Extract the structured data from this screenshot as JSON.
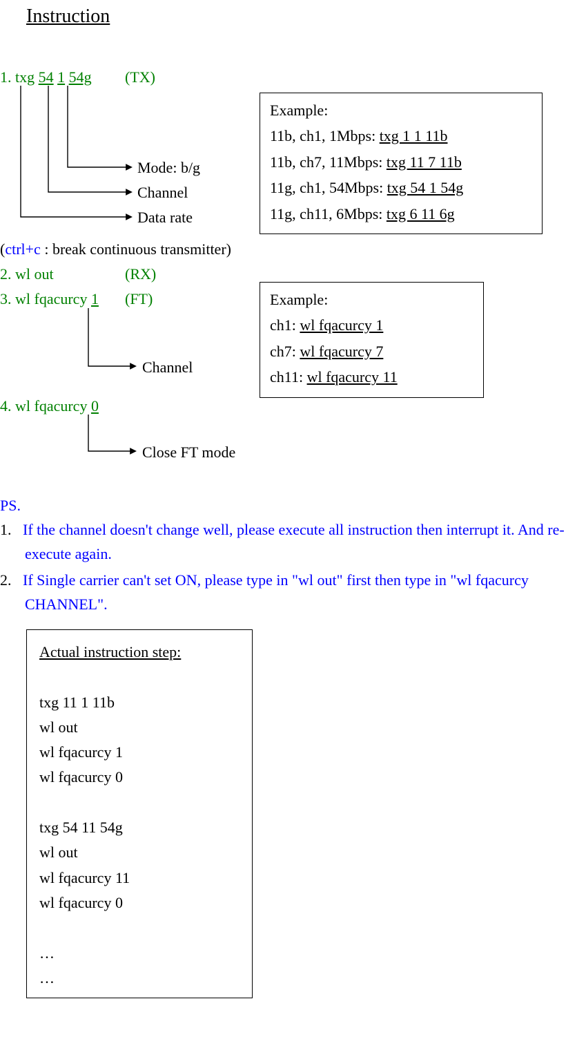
{
  "title": "Instruction",
  "step1": {
    "prefix": "1. txg ",
    "p1": "54",
    "p2": "1",
    "p3": "54g",
    "tag": "(TX)",
    "labels": {
      "mode": "Mode: b/g",
      "channel": "Channel",
      "rate": "Data rate"
    }
  },
  "box1": {
    "head": "Example:",
    "r1a": "11b, ch1, 1Mbps: ",
    "r1b": "txg 1 1 11b",
    "r2a": "11b, ch7, 11Mbps: ",
    "r2b": "txg 11 7 11b",
    "r3a": "11g, ch1, 54Mbps: ",
    "r3b": "txg 54 1 54g",
    "r4a": "11g, ch11, 6Mbps: ",
    "r4b": "txg 6 11 6g"
  },
  "break": {
    "open": "(",
    "key": "ctrl+c",
    "rest": " : break continuous transmitter)"
  },
  "step2": {
    "cmd": "2. wl out",
    "tag": "(RX)"
  },
  "step3": {
    "prefix": "3. wl fqacurcy ",
    "arg": "1",
    "tag": "(FT)",
    "label": "Channel"
  },
  "box2": {
    "head": "Example:",
    "r1a": "ch1: ",
    "r1b": "wl fqacurcy 1",
    "r2a": "ch7: ",
    "r2b": "wl fqacurcy 7",
    "r3a": "ch11: ",
    "r3b": "wl fqacurcy 11"
  },
  "step4": {
    "prefix": "4. wl fqacurcy ",
    "arg": "0",
    "label": "Close FT mode"
  },
  "ps": {
    "head": "PS.",
    "i1": "If the channel doesn't change well, please execute all instruction then interrupt it. And re-execute again.",
    "i2": "If Single carrier can't set ON, please type in \"wl out\" first then type in \"wl fqacurcy CHANNEL\"."
  },
  "box3": {
    "head": "Actual instruction step:",
    "l1": "txg 11 1 11b",
    "l2": "wl out",
    "l3": "wl fqacurcy 1",
    "l4": "wl fqacurcy 0",
    "l5": "txg 54 11 54g",
    "l6": "wl out",
    "l7": "wl fqacurcy 11",
    "l8": "wl fqacurcy 0",
    "l9": "…",
    "l10": "…"
  }
}
